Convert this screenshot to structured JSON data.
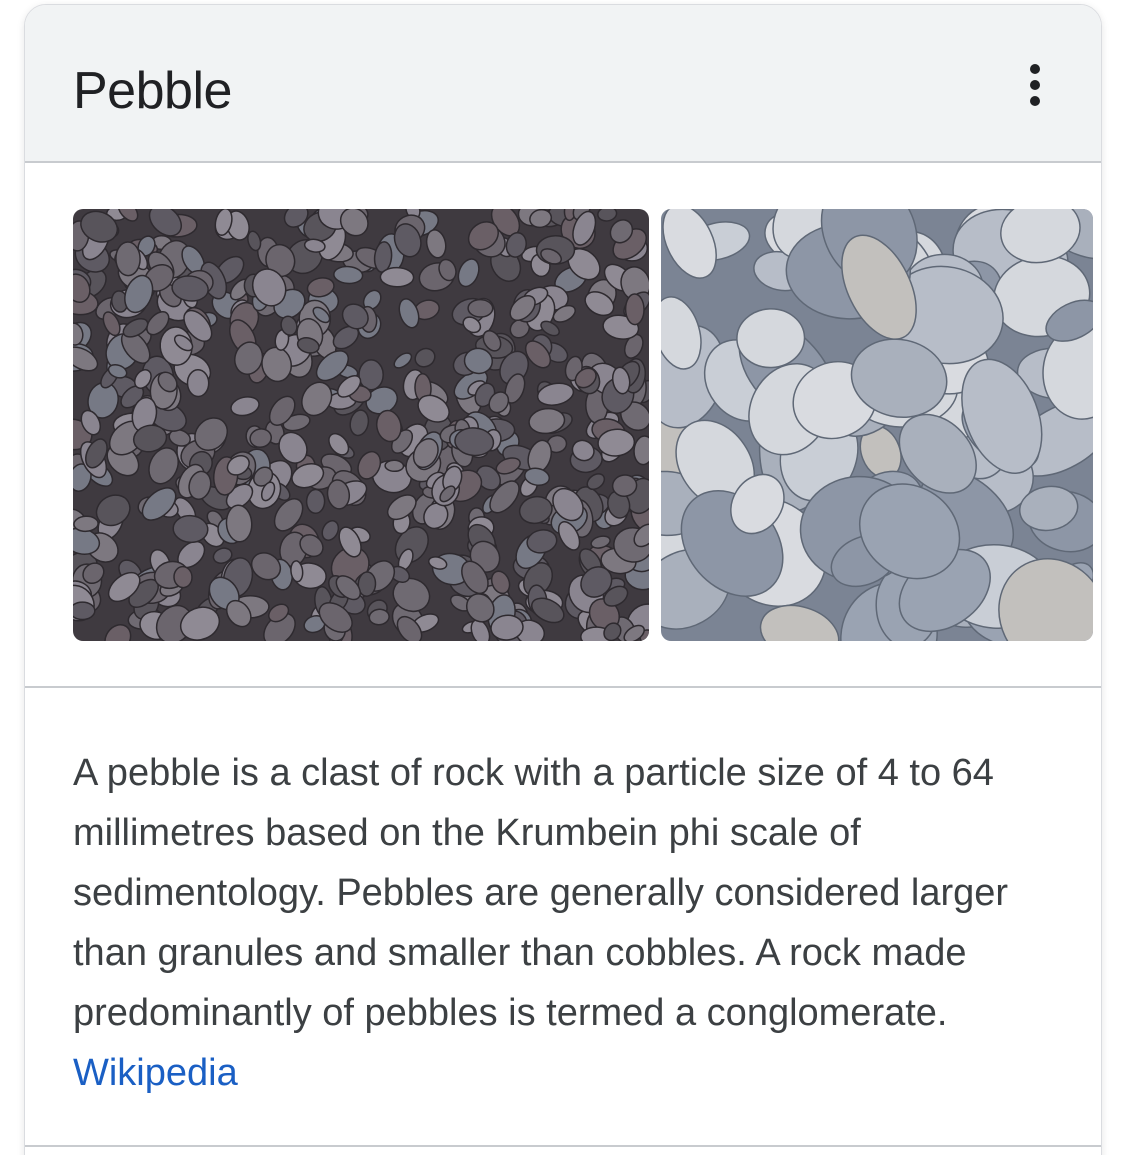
{
  "header": {
    "title": "Pebble",
    "more_icon": "more-vert-icon"
  },
  "images": [
    {
      "description_icon": "dark-pebbles-photo"
    },
    {
      "description_icon": "light-pebbles-photo"
    },
    {
      "description_icon": "partial-pebbles-photo"
    }
  ],
  "description": {
    "text": "A pebble is a clast of rock with a particle size of 4 to 64 millimetres based on the Krumbein phi scale of sedimentology. Pebbles are generally considered larger than granules and smaller than cobbles. A rock made predominantly of pebbles is termed a conglomerate.",
    "source_label": "Wikipedia"
  },
  "colors": {
    "header_bg": "#f1f3f4",
    "link": "#1a5fc4",
    "text": "#3c4043",
    "title": "#202124"
  }
}
